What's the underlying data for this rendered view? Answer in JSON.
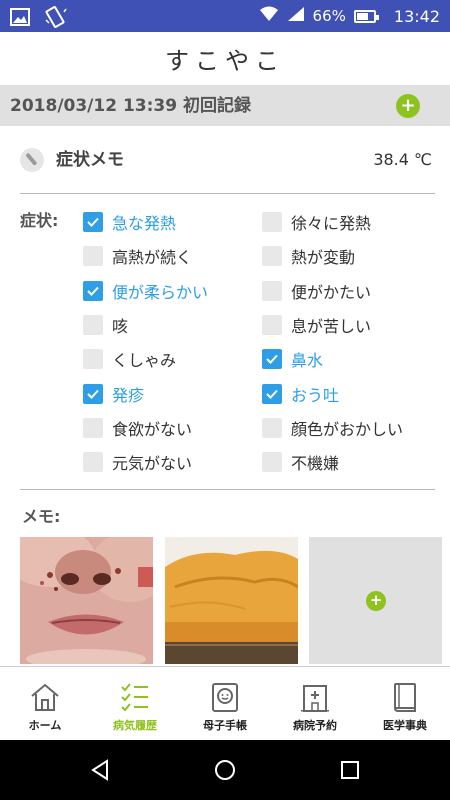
{
  "status_bar": {
    "battery": "66%",
    "time": "13:42",
    "battery_fraction": 0.66
  },
  "header": {
    "title": "すこやこ"
  },
  "record": {
    "date_title": "2018/03/12 13:39 初回記録",
    "add_label": "+"
  },
  "symptom_memo": {
    "label": "症状メモ",
    "temperature": "38.4 ℃"
  },
  "symptoms": {
    "title": "症状:",
    "items": [
      {
        "label": "急な発熱",
        "checked": true
      },
      {
        "label": "徐々に発熱",
        "checked": false
      },
      {
        "label": "高熱が続く",
        "checked": false
      },
      {
        "label": "熱が変動",
        "checked": false
      },
      {
        "label": "便が柔らかい",
        "checked": true
      },
      {
        "label": "便がかたい",
        "checked": false
      },
      {
        "label": "咳",
        "checked": false
      },
      {
        "label": "息が苦しい",
        "checked": false
      },
      {
        "label": "くしゃみ",
        "checked": false
      },
      {
        "label": "鼻水",
        "checked": true
      },
      {
        "label": "発疹",
        "checked": true
      },
      {
        "label": "おう吐",
        "checked": true
      },
      {
        "label": "食欲がない",
        "checked": false
      },
      {
        "label": "顔色がおかしい",
        "checked": false
      },
      {
        "label": "元気がない",
        "checked": false
      },
      {
        "label": "不機嫌",
        "checked": false
      }
    ]
  },
  "memo": {
    "label": "メモ:",
    "add_label": "+"
  },
  "bottom_nav": {
    "items": [
      {
        "label": "ホーム",
        "icon": "home-icon",
        "active": false
      },
      {
        "label": "病気履歴",
        "icon": "checklist-icon",
        "active": true
      },
      {
        "label": "母子手帳",
        "icon": "baby-book-icon",
        "active": false
      },
      {
        "label": "病院予約",
        "icon": "hospital-icon",
        "active": false
      },
      {
        "label": "医学事典",
        "icon": "book-icon",
        "active": false
      }
    ]
  },
  "colors": {
    "status_bar": "#3f51b5",
    "accent_blue": "#2e9fe6",
    "accent_green": "#8dc21f"
  }
}
